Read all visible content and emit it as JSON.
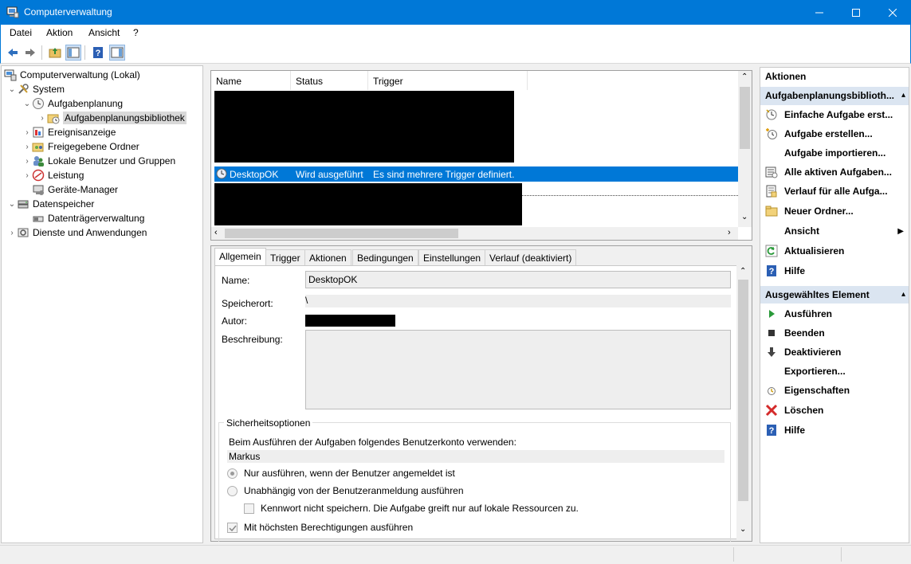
{
  "window": {
    "title": "Computerverwaltung"
  },
  "menu": {
    "items": [
      "Datei",
      "Aktion",
      "Ansicht",
      "?"
    ]
  },
  "tree": {
    "items": [
      {
        "label": "Computerverwaltung (Lokal)"
      },
      {
        "label": "System"
      },
      {
        "label": "Aufgabenplanung"
      },
      {
        "label": "Aufgabenplanungsbibliothek"
      },
      {
        "label": "Ereignisanzeige"
      },
      {
        "label": "Freigegebene Ordner"
      },
      {
        "label": "Lokale Benutzer und Gruppen"
      },
      {
        "label": "Leistung"
      },
      {
        "label": "Geräte-Manager"
      },
      {
        "label": "Datenspeicher"
      },
      {
        "label": "Datenträgerverwaltung"
      },
      {
        "label": "Dienste und Anwendungen"
      }
    ]
  },
  "list": {
    "columns": [
      "Name",
      "Status",
      "Trigger"
    ],
    "selected": {
      "name": "DesktopOK",
      "status": "Wird ausgeführt",
      "trigger": "Es sind mehrere Trigger definiert."
    }
  },
  "details": {
    "tabs": [
      "Allgemein",
      "Trigger",
      "Aktionen",
      "Bedingungen",
      "Einstellungen",
      "Verlauf (deaktiviert)"
    ],
    "name_label": "Name:",
    "name_value": "DesktopOK",
    "location_label": "Speicherort:",
    "location_value": "\\",
    "author_label": "Autor:",
    "description_label": "Beschreibung:",
    "security": {
      "title": "Sicherheitsoptionen",
      "account_prompt": "Beim Ausführen der Aufgaben folgendes Benutzerkonto verwenden:",
      "account": "Markus",
      "radio1": "Nur ausführen, wenn der Benutzer angemeldet ist",
      "radio2": "Unabhängig von der Benutzeranmeldung ausführen",
      "checkbox_password": "Kennwort nicht speichern. Die Aufgabe greift nur auf lokale Ressourcen zu.",
      "checkbox_highest": "Mit höchsten Berechtigungen ausführen"
    }
  },
  "actions": {
    "header": "Aktionen",
    "section1": "Aufgabenplanungsbiblioth...",
    "items1": [
      "Einfache Aufgabe erst...",
      "Aufgabe erstellen...",
      "Aufgabe importieren...",
      "Alle aktiven Aufgaben...",
      "Verlauf für alle Aufga...",
      "Neuer Ordner...",
      "Ansicht",
      "Aktualisieren",
      "Hilfe"
    ],
    "section2": "Ausgewähltes Element",
    "items2": [
      "Ausführen",
      "Beenden",
      "Deaktivieren",
      "Exportieren...",
      "Eigenschaften",
      "Löschen",
      "Hilfe"
    ]
  }
}
